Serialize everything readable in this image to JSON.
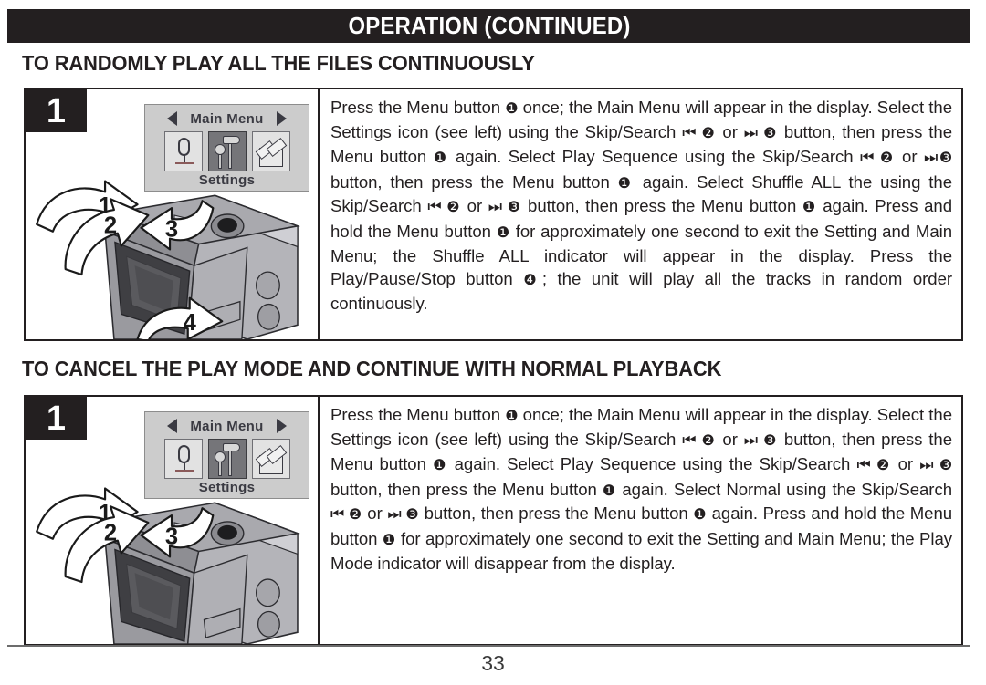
{
  "header": {
    "title": "OPERATION (CONTINUED)"
  },
  "sections": [
    {
      "heading": "TO RANDOMLY PLAY ALL THE FILES CONTINUOUSLY",
      "step_number": "1",
      "lcd": {
        "title": "Main Menu",
        "caption": "Settings",
        "left_arrow": "arrow-left-icon",
        "right_arrow": "arrow-right-icon",
        "icons": [
          {
            "name": "microphone-icon",
            "selected": false
          },
          {
            "name": "tools-settings-icon",
            "selected": true
          },
          {
            "name": "files-icon",
            "selected": false
          }
        ]
      },
      "callouts": [
        "1",
        "2",
        "3",
        "4"
      ],
      "instruction_parts": [
        {
          "t": "text",
          "v": "Press the Menu button "
        },
        {
          "t": "num",
          "v": "❶"
        },
        {
          "t": "text",
          "v": " once; the Main Menu will appear in the display. Select the Settings icon (see left) using the Skip/Search "
        },
        {
          "t": "glyph",
          "v": "⏮"
        },
        {
          "t": "text",
          "v": " "
        },
        {
          "t": "num",
          "v": "❷"
        },
        {
          "t": "text",
          "v": " or "
        },
        {
          "t": "glyph",
          "v": "⏭"
        },
        {
          "t": "text",
          "v": " "
        },
        {
          "t": "num",
          "v": "❸"
        },
        {
          "t": "text",
          "v": " button, then press the Menu button "
        },
        {
          "t": "num",
          "v": "❶"
        },
        {
          "t": "text",
          "v": " again. Select Play Sequence using the Skip/Search "
        },
        {
          "t": "glyph",
          "v": "⏮"
        },
        {
          "t": "text",
          "v": " "
        },
        {
          "t": "num",
          "v": "❷"
        },
        {
          "t": "text",
          "v": " or "
        },
        {
          "t": "glyph",
          "v": "⏭"
        },
        {
          "t": "num",
          "v": "❸"
        },
        {
          "t": "text",
          "v": " button, then press the Menu button "
        },
        {
          "t": "num",
          "v": "❶"
        },
        {
          "t": "text",
          "v": " again. Select Shuffle ALL the using the Skip/Search "
        },
        {
          "t": "glyph",
          "v": "⏮"
        },
        {
          "t": "text",
          "v": " "
        },
        {
          "t": "num",
          "v": "❷"
        },
        {
          "t": "text",
          "v": " or "
        },
        {
          "t": "glyph",
          "v": "⏭"
        },
        {
          "t": "text",
          "v": " "
        },
        {
          "t": "num",
          "v": "❸"
        },
        {
          "t": "text",
          "v": " button, then press the Menu button "
        },
        {
          "t": "num",
          "v": "❶"
        },
        {
          "t": "text",
          "v": " again. Press and hold the Menu button "
        },
        {
          "t": "num",
          "v": "❶"
        },
        {
          "t": "text",
          "v": " for approximately one second to exit the Setting and Main Menu; the Shuffle ALL  indicator will appear in the display. Press the Play/Pause/Stop button "
        },
        {
          "t": "num",
          "v": "❹"
        },
        {
          "t": "text",
          "v": "; the unit will play all the tracks in random order continuously."
        }
      ]
    },
    {
      "heading": "TO CANCEL THE PLAY MODE AND CONTINUE WITH NORMAL PLAYBACK",
      "step_number": "1",
      "lcd": {
        "title": "Main Menu",
        "caption": "Settings",
        "left_arrow": "arrow-left-icon",
        "right_arrow": "arrow-right-icon",
        "icons": [
          {
            "name": "microphone-icon",
            "selected": false
          },
          {
            "name": "tools-settings-icon",
            "selected": true
          },
          {
            "name": "files-icon",
            "selected": false
          }
        ]
      },
      "callouts": [
        "1",
        "2",
        "3"
      ],
      "instruction_parts": [
        {
          "t": "text",
          "v": "Press the Menu button "
        },
        {
          "t": "num",
          "v": "❶"
        },
        {
          "t": "text",
          "v": " once; the Main Menu will appear in the display. Select the Settings icon (see left) using the Skip/Search "
        },
        {
          "t": "glyph",
          "v": "⏮"
        },
        {
          "t": "text",
          "v": " "
        },
        {
          "t": "num",
          "v": "❷"
        },
        {
          "t": "text",
          "v": " or "
        },
        {
          "t": "glyph",
          "v": "⏭"
        },
        {
          "t": "text",
          "v": " "
        },
        {
          "t": "num",
          "v": "❸"
        },
        {
          "t": "text",
          "v": " button, then press the Menu button "
        },
        {
          "t": "num",
          "v": "❶"
        },
        {
          "t": "text",
          "v": " again. Select Play Sequence using the Skip/Search "
        },
        {
          "t": "glyph",
          "v": "⏮"
        },
        {
          "t": "text",
          "v": " "
        },
        {
          "t": "num",
          "v": "❷"
        },
        {
          "t": "text",
          "v": " or "
        },
        {
          "t": "glyph",
          "v": "⏭"
        },
        {
          "t": "text",
          "v": " "
        },
        {
          "t": "num",
          "v": "❸"
        },
        {
          "t": "text",
          "v": " button, then press the Menu button "
        },
        {
          "t": "num",
          "v": "❶"
        },
        {
          "t": "text",
          "v": " again. Select Normal using the Skip/Search "
        },
        {
          "t": "glyph",
          "v": "⏮"
        },
        {
          "t": "text",
          "v": " "
        },
        {
          "t": "num",
          "v": "❷"
        },
        {
          "t": "text",
          "v": " or "
        },
        {
          "t": "glyph",
          "v": "⏭"
        },
        {
          "t": "text",
          "v": " "
        },
        {
          "t": "num",
          "v": "❸"
        },
        {
          "t": "text",
          "v": " button, then press the Menu button "
        },
        {
          "t": "num",
          "v": "❶"
        },
        {
          "t": "text",
          "v": " again. Press and hold the Menu button "
        },
        {
          "t": "num",
          "v": "❶"
        },
        {
          "t": "text",
          "v": " for approximately one second to exit the Setting and Main Menu; the Play Mode indicator will disappear from the display."
        }
      ]
    }
  ],
  "footer": {
    "page_number": "33"
  },
  "colors": {
    "ink": "#231f20",
    "banner_bg": "#231f20",
    "banner_text": "#ffffff",
    "lcd_bg": "#cccccc",
    "lcd_selected": "#757579",
    "device_body": "#9a9a9f",
    "device_screen": "#4a4a4e"
  }
}
